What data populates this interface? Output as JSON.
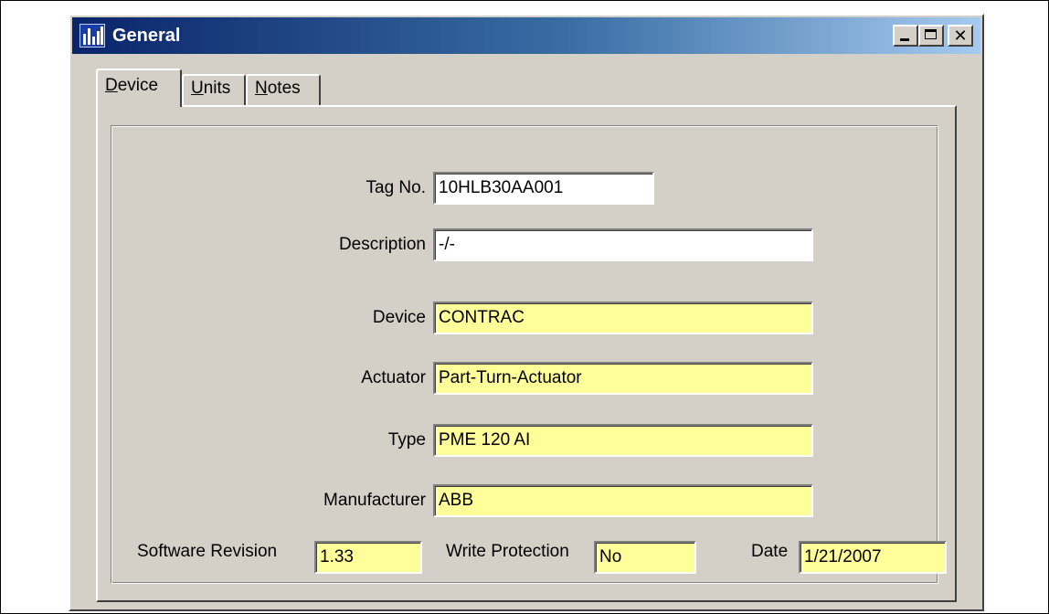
{
  "window": {
    "title": "General"
  },
  "tabs": [
    {
      "label_underline": "D",
      "label_rest": "evice"
    },
    {
      "label_underline": "U",
      "label_rest": "nits"
    },
    {
      "label_underline": "N",
      "label_rest": "otes"
    }
  ],
  "fields": {
    "tag_no": {
      "label": "Tag No.",
      "value": "10HLB30AA001"
    },
    "description": {
      "label": "Description",
      "value": "-/-"
    },
    "device": {
      "label": "Device",
      "value": "CONTRAC"
    },
    "actuator": {
      "label": "Actuator",
      "value": "Part-Turn-Actuator"
    },
    "type": {
      "label": "Type",
      "value": "PME 120 AI"
    },
    "manufacturer": {
      "label": "Manufacturer",
      "value": "ABB"
    },
    "software_revision": {
      "label": "Software Revision",
      "value": "1.33"
    },
    "write_protection": {
      "label": "Write Protection",
      "value": "No"
    },
    "date": {
      "label": "Date",
      "value": "1/21/2007"
    }
  },
  "colors": {
    "readonly_field": "#ffff99",
    "editable_field": "#ffffff",
    "dialog_face": "#d4d0c8",
    "title_gradient_start": "#0a246a",
    "title_gradient_end": "#a6caf0"
  },
  "icons": {
    "app": "equipment-chart-icon",
    "minimize": "minimize-icon",
    "maximize": "maximize-icon",
    "close": "close-icon"
  }
}
